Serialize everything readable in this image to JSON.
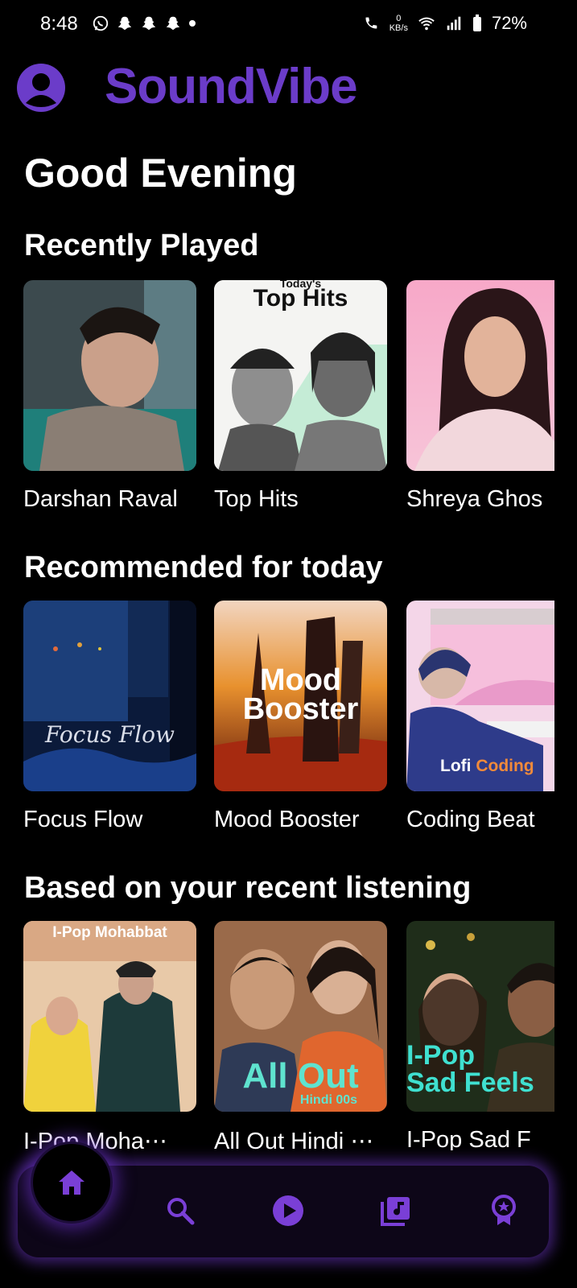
{
  "status_bar": {
    "time": "8:48",
    "battery": "72%",
    "data_speed_value": "0",
    "data_speed_unit": "KB/s"
  },
  "header": {
    "app_name": "SoundVibe"
  },
  "greeting": "Good Evening",
  "sections": [
    {
      "title": "Recently Played",
      "items": [
        {
          "label": "Darshan Raval"
        },
        {
          "label": "Top Hits",
          "art_text_small": "Today's",
          "art_text": "Top Hits"
        },
        {
          "label": "Shreya Ghos"
        }
      ]
    },
    {
      "title": "Recommended for today",
      "items": [
        {
          "label": "Focus Flow",
          "art_text": "Focus Flow"
        },
        {
          "label": "Mood Booster",
          "art_text_line1": "Mood",
          "art_text_line2": "Booster"
        },
        {
          "label": "Coding Beat",
          "art_text_white": "Lofi",
          "art_text_orange": "Coding"
        }
      ]
    },
    {
      "title": "Based on your recent listening",
      "items": [
        {
          "label": "I-Pop Moha⋯",
          "art_text": "I-Pop Mohabbat"
        },
        {
          "label": "All Out Hindi ⋯",
          "art_text": "All Out",
          "art_text_small": "Hindi 00s"
        },
        {
          "label": "I-Pop Sad F",
          "art_text_line1": "I-Pop",
          "art_text_line2": "Sad Feels"
        }
      ]
    }
  ],
  "colors": {
    "brand": "#6b3cc9",
    "nav_icon": "#7a3fd6",
    "background": "#000000"
  },
  "nav": [
    "home-icon",
    "search-icon",
    "play-icon",
    "library-icon",
    "badge-icon"
  ]
}
